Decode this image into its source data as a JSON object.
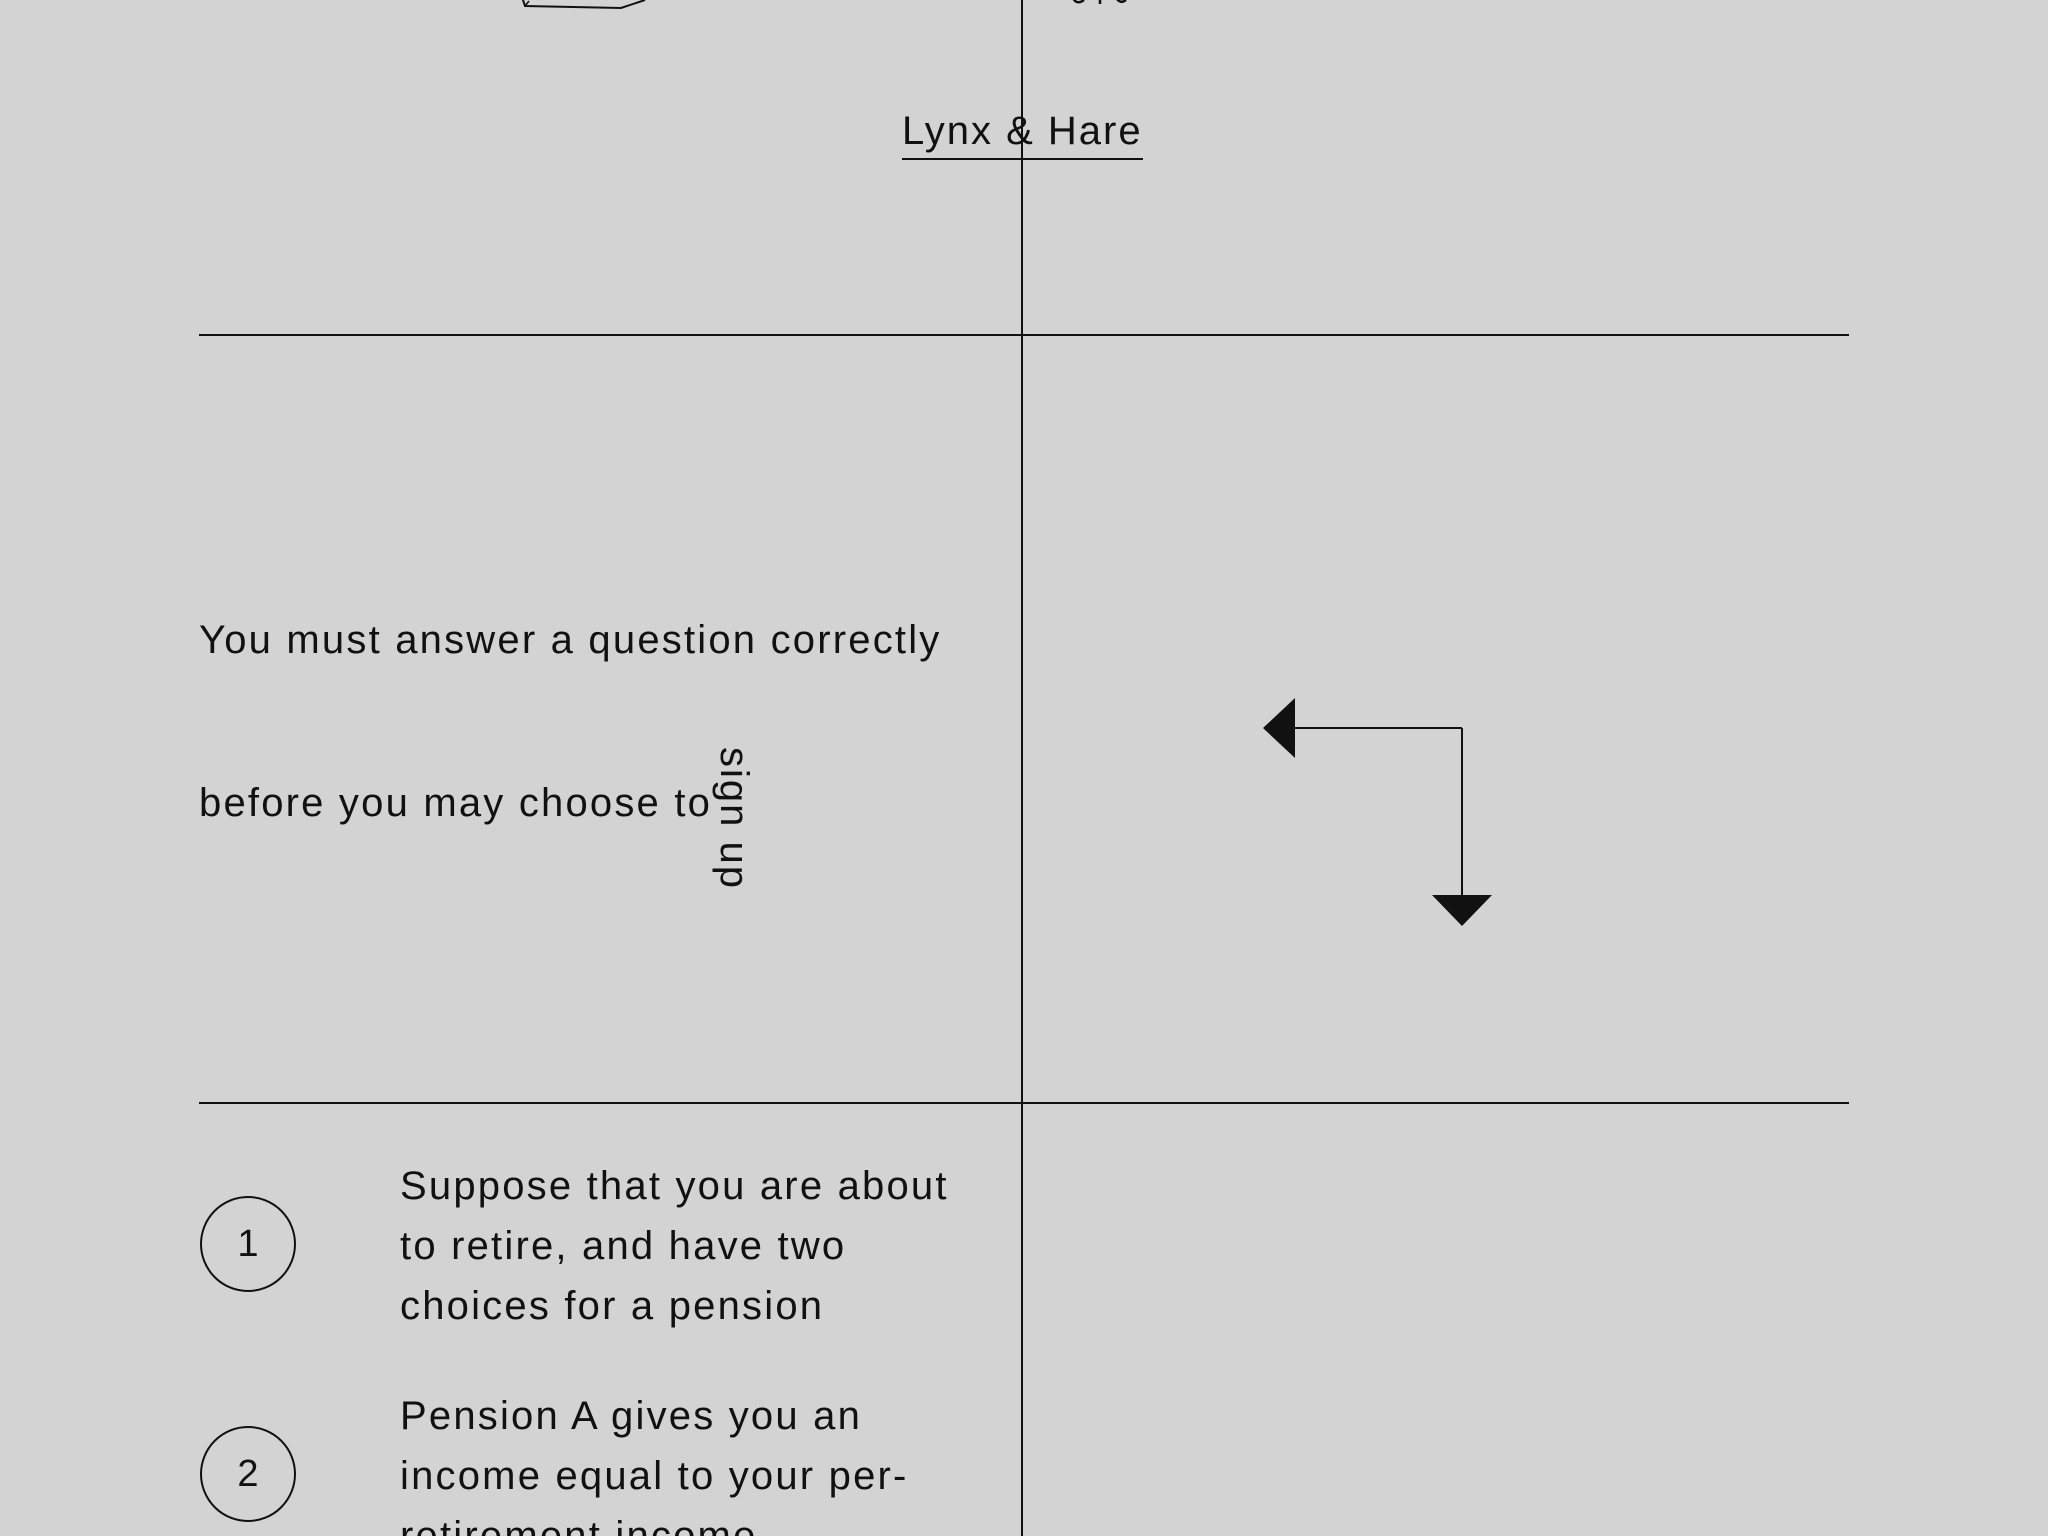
{
  "header": {
    "brand_link": "Lynx & Hare"
  },
  "intro": {
    "line_1": "You must answer a question correctly",
    "line_2": "before you may choose to",
    "signup_link": "sign up"
  },
  "steps": [
    {
      "number": "1",
      "lines": [
        "Suppose that you are about",
        "to retire, and have two",
        "choices for a pension"
      ]
    },
    {
      "number": "2",
      "lines": [
        "Pension A gives you an",
        "income equal to your per-",
        "retirement income"
      ]
    }
  ],
  "icons": {
    "top_illustration": "box-illustration-icon",
    "arrows": "left-down-arrows-icon"
  },
  "colors": {
    "background": "#d3d3d3",
    "ink": "#111111"
  }
}
